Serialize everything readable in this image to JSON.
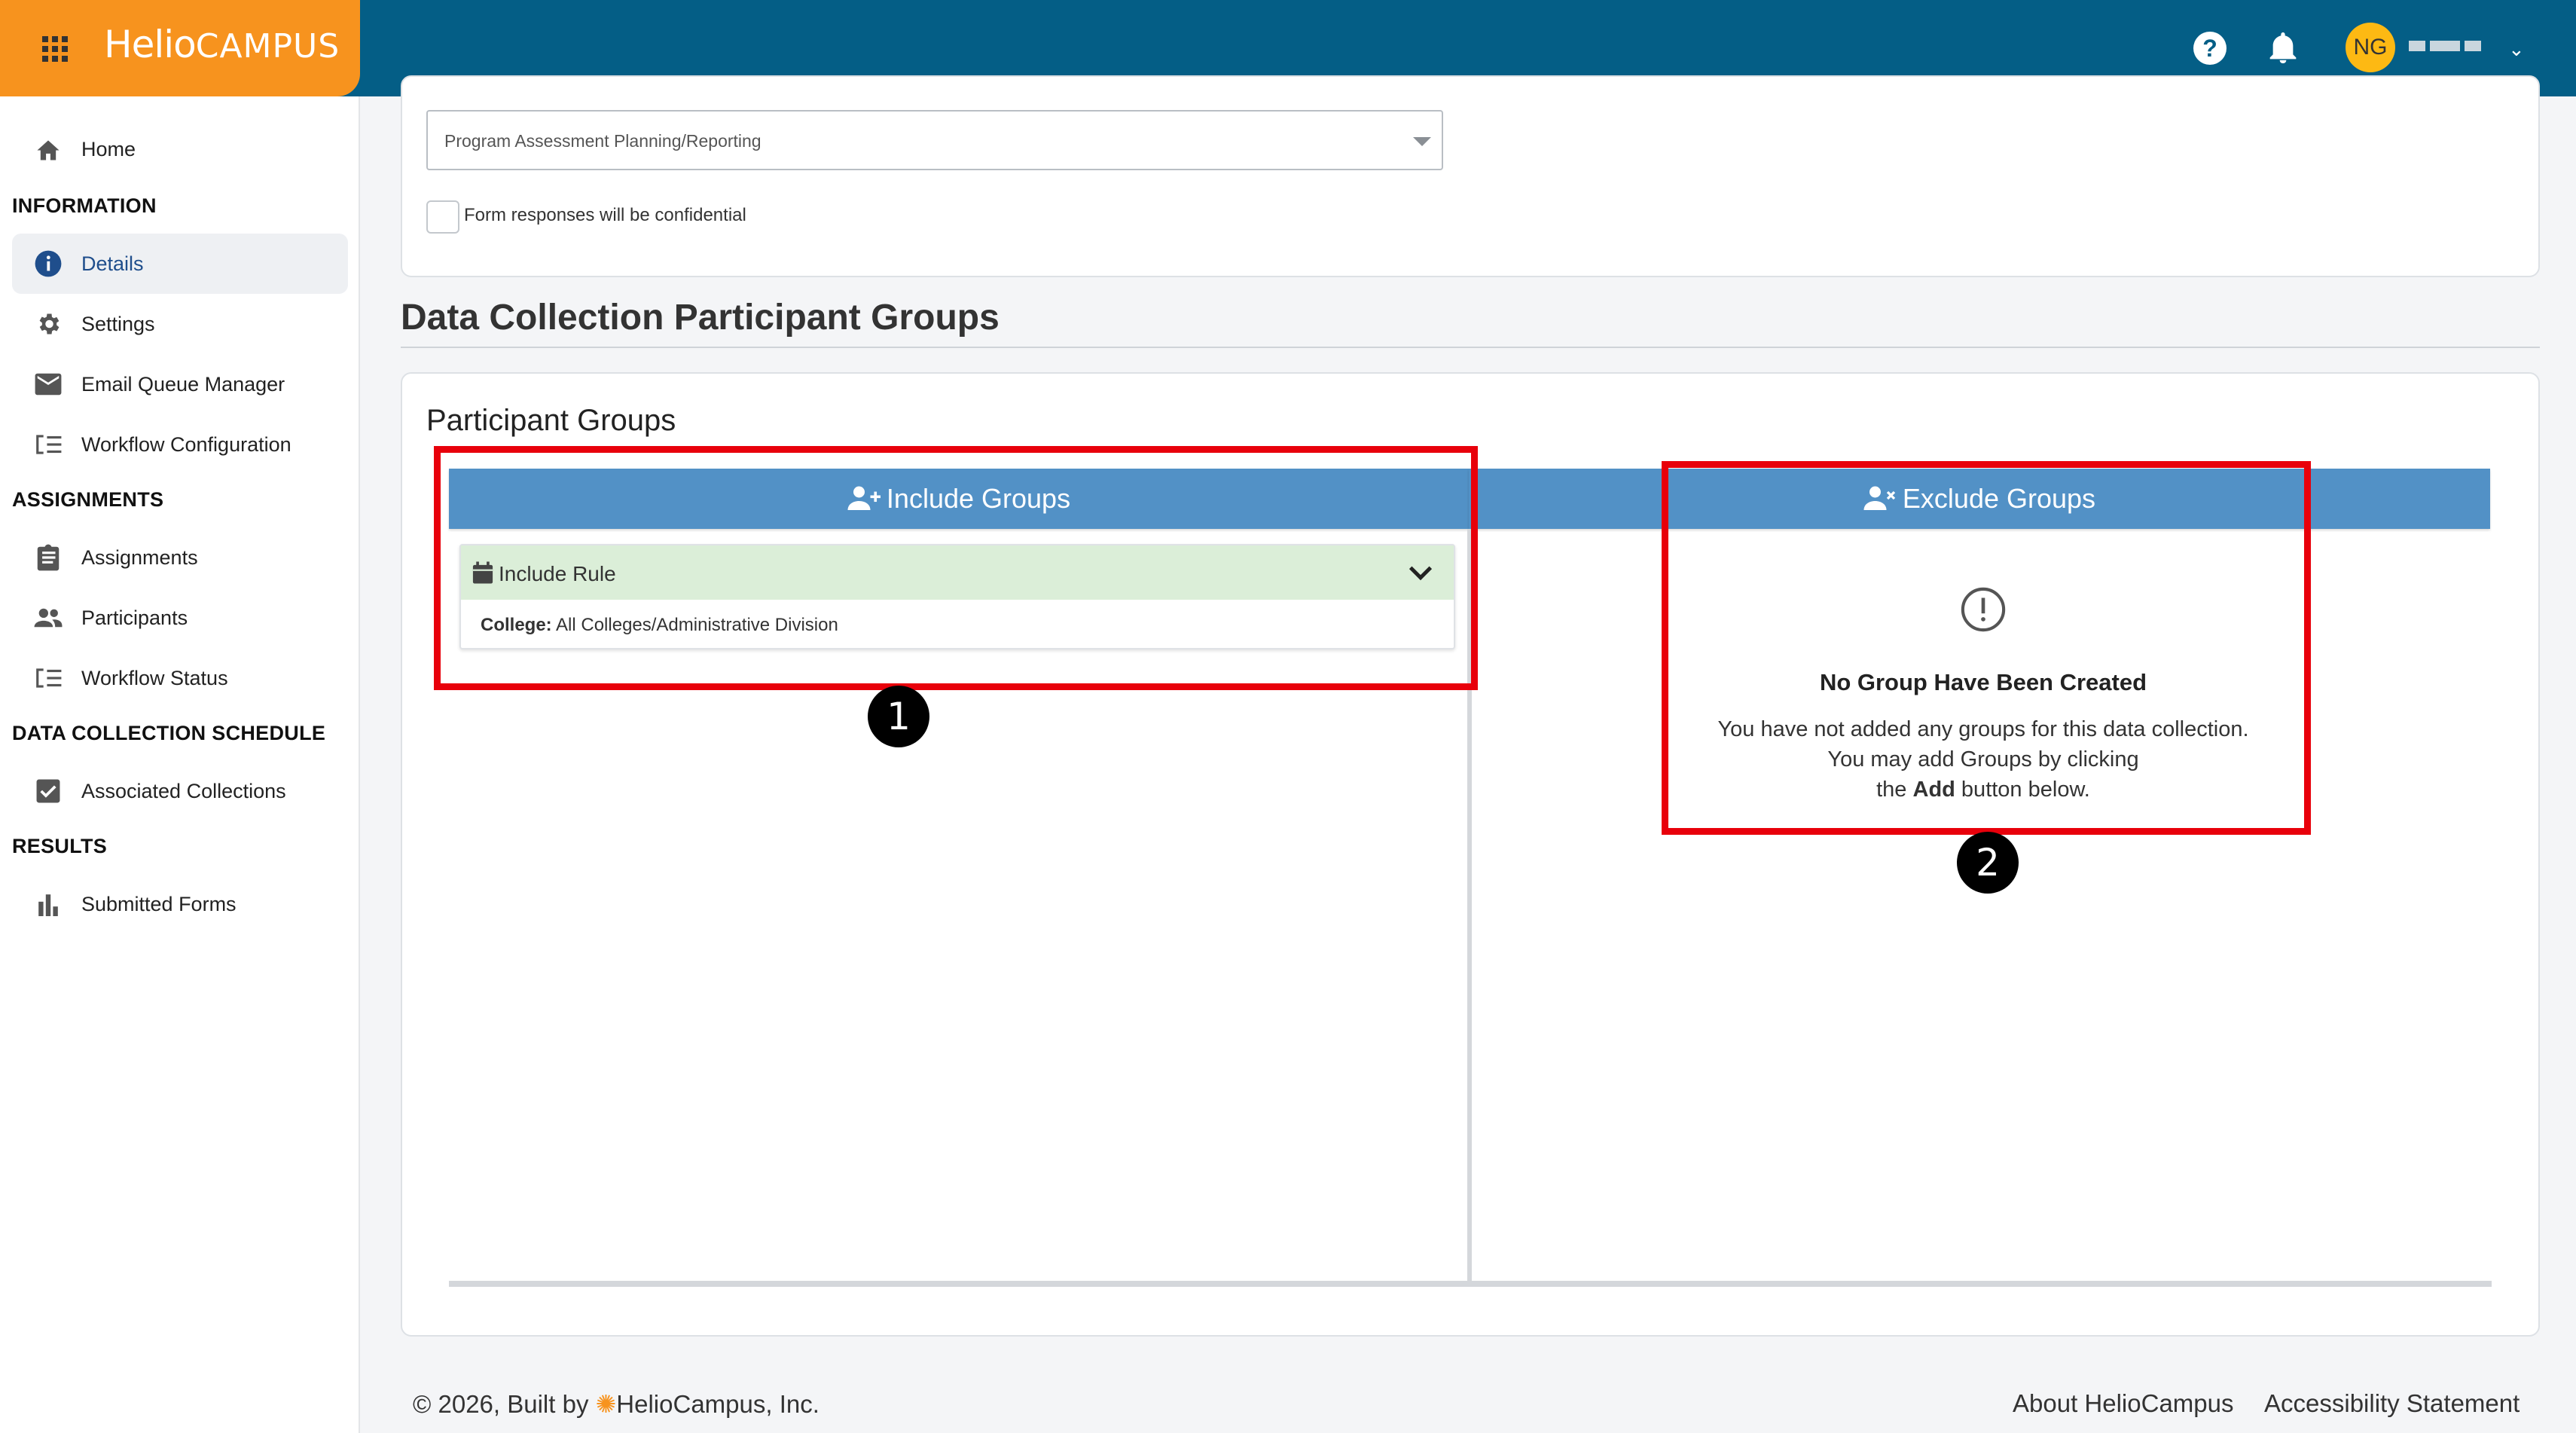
{
  "header": {
    "brand_helio": "Helio",
    "brand_campus": "CAMPUS",
    "help_glyph": "?",
    "avatar_initials": "NG",
    "user_chevron": "⌄"
  },
  "sidebar": {
    "home": "Home",
    "sections": {
      "information": "INFORMATION",
      "assignments": "ASSIGNMENTS",
      "schedule": "DATA COLLECTION SCHEDULE",
      "results": "RESULTS"
    },
    "items": {
      "details": "Details",
      "settings": "Settings",
      "email_queue": "Email Queue Manager",
      "workflow_config": "Workflow Configuration",
      "assignments": "Assignments",
      "participants": "Participants",
      "workflow_status": "Workflow Status",
      "associated_collections": "Associated Collections",
      "submitted_forms": "Submitted Forms"
    }
  },
  "form": {
    "select_value": "Program Assessment Planning/Reporting",
    "confidential_label": "Form responses will be confidential"
  },
  "participant_section": {
    "title": "Data Collection Participant Groups",
    "card_title": "Participant Groups",
    "include_header": "Include Groups",
    "exclude_header": "Exclude Groups",
    "include_rule_title": "Include Rule",
    "rule_key": "College:",
    "rule_value": " All Colleges/Administrative Division",
    "empty_title": "No Group Have Been Created",
    "empty_line1": "You have not added any groups for this data collection.",
    "empty_line2": "You may add Groups by clicking",
    "empty_line3_pre": "the ",
    "empty_line3_bold": "Add",
    "empty_line3_post": " button below."
  },
  "annotations": {
    "badge_1": "1",
    "badge_2": "2"
  },
  "footer": {
    "copyright_pre": "© 2026, Built by ",
    "sun_glyph": "✺",
    "copyright_post": "HelioCampus, Inc.",
    "about": "About HelioCampus",
    "accessibility": "Accessibility Statement"
  },
  "colors": {
    "topbar": "#045e86",
    "brand": "#f7931e",
    "group_header": "#5291c6",
    "rule_header": "#dbeed8",
    "highlight": "#e8000b"
  }
}
